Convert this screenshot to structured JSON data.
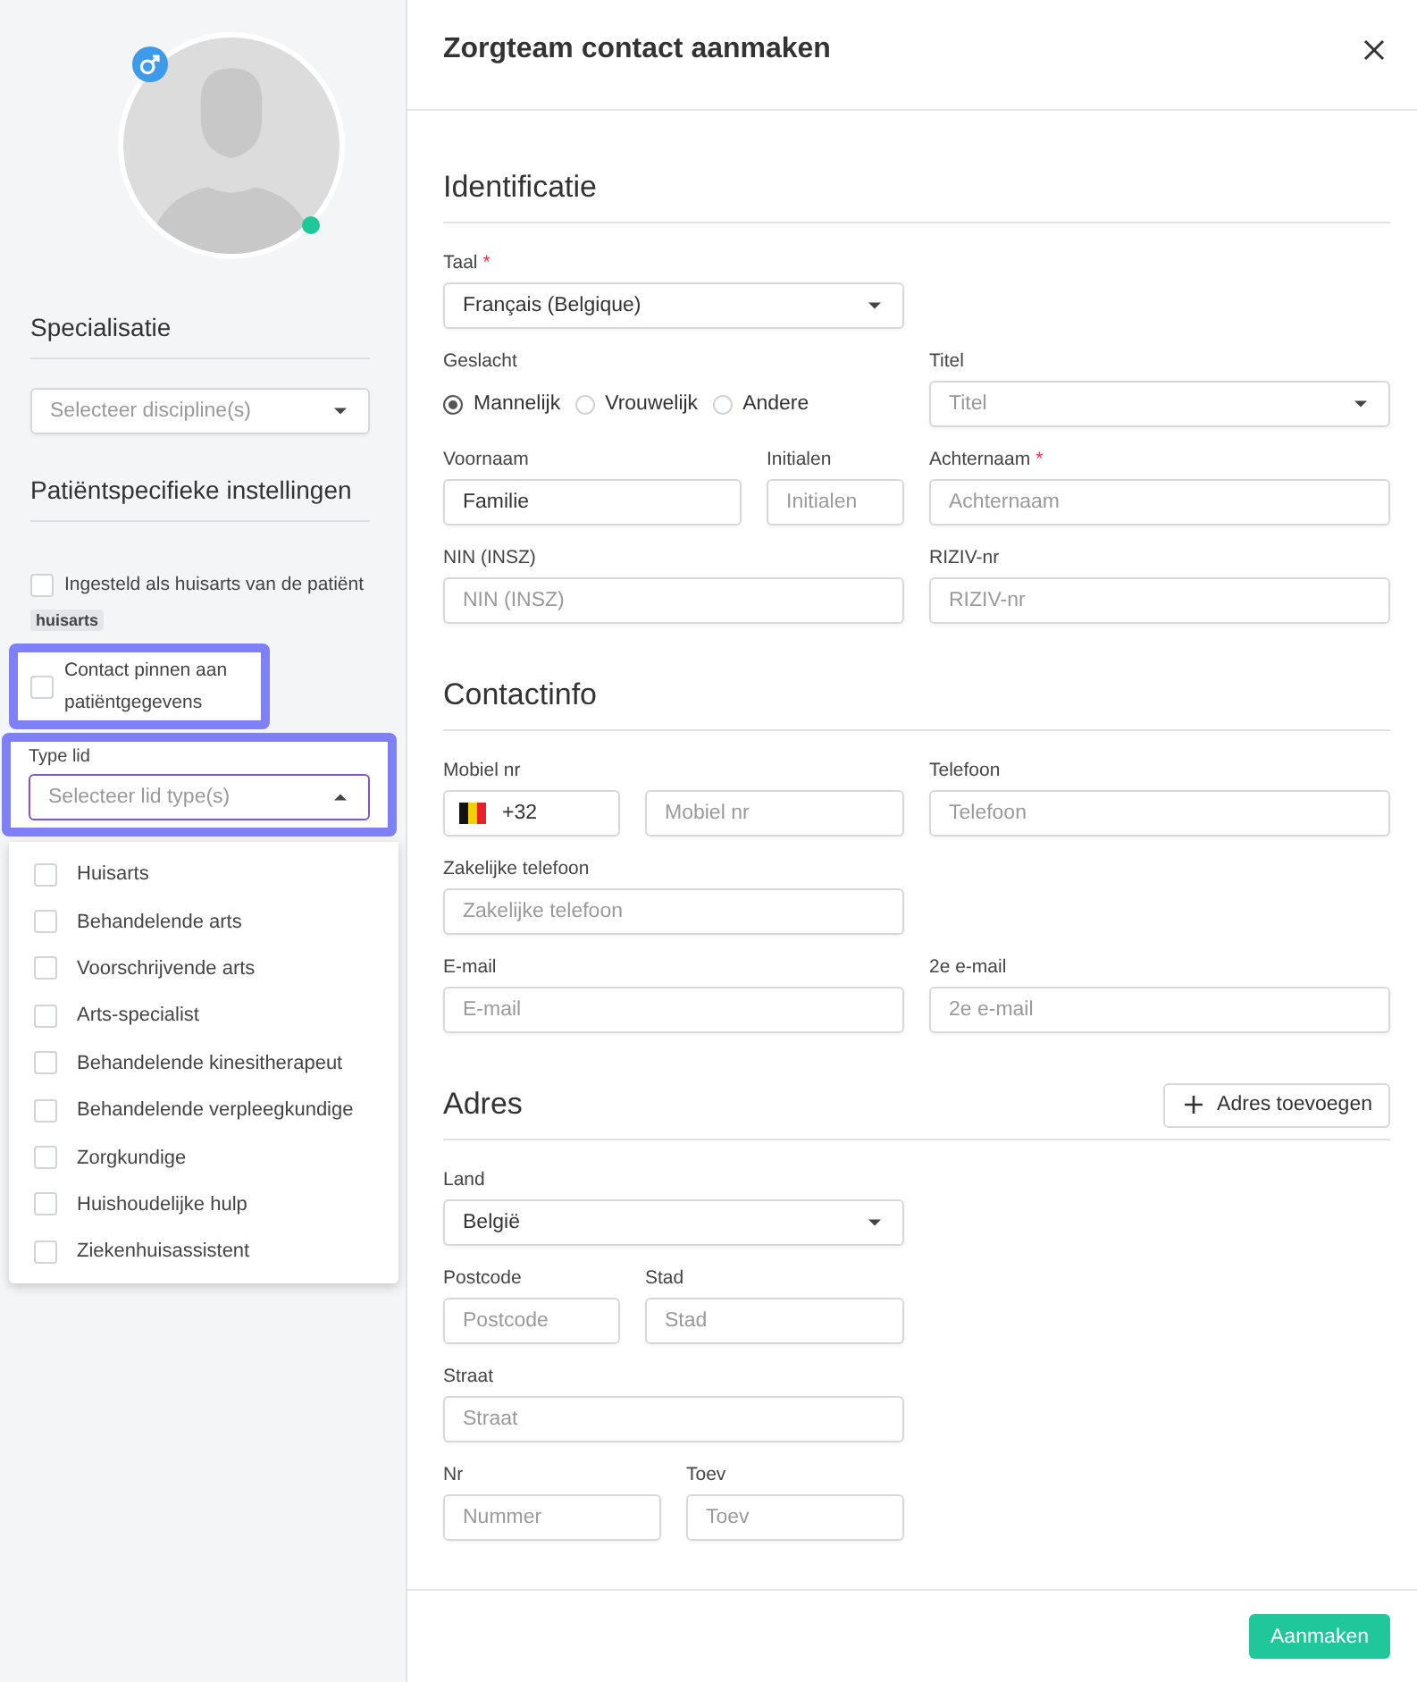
{
  "sidebar": {
    "avatar": {
      "online": true
    },
    "specialisation": {
      "heading": "Specialisatie",
      "placeholder": "Selecteer discipline(s)"
    },
    "patient_settings": {
      "heading": "Patiëntspecifieke instellingen",
      "checkboxes": [
        {
          "label": "Ingesteld als huisarts van de patiënt",
          "checked": false,
          "tag": "huisarts",
          "highlighted": false
        },
        {
          "label": "Contact pinnen aan patiëntgegevens",
          "checked": false,
          "highlighted": true
        }
      ]
    },
    "member_type": {
      "label": "Type lid",
      "placeholder": "Selecteer lid type(s)",
      "expanded": true,
      "highlighted": true,
      "options": [
        {
          "label": "Huisarts",
          "checked": false
        },
        {
          "label": "Behandelende arts",
          "checked": false
        },
        {
          "label": "Voorschrijvende arts",
          "checked": false
        },
        {
          "label": "Arts-specialist",
          "checked": false
        },
        {
          "label": "Behandelende kinesitherapeut",
          "checked": false
        },
        {
          "label": "Behandelende verpleegkundige",
          "checked": false
        },
        {
          "label": "Zorgkundige",
          "checked": false
        },
        {
          "label": "Huishoudelijke hulp",
          "checked": false
        },
        {
          "label": "Ziekenhuisassistent",
          "checked": false
        }
      ]
    }
  },
  "dialog": {
    "title": "Zorgteam contact aanmaken",
    "sections": [
      {
        "heading": "Identificatie",
        "rows": [
          [
            {
              "kind": "select",
              "label": "Taal",
              "required_mark": "*",
              "value": "Français (Belgique)"
            }
          ],
          [
            {
              "kind": "radio",
              "label": "Geslacht",
              "options": [
                {
                  "label": "Mannelijk",
                  "selected": true
                },
                {
                  "label": "Vrouwelijk",
                  "selected": false
                },
                {
                  "label": "Andere",
                  "selected": false
                }
              ]
            },
            {
              "kind": "select",
              "label": "Titel",
              "placeholder": "Titel"
            }
          ],
          [
            {
              "kind": "text",
              "label": "Voornaam",
              "value": "Familie"
            },
            {
              "kind": "text",
              "label": "Initialen",
              "placeholder": "Initialen"
            },
            {
              "kind": "text",
              "label": "Achternaam",
              "required_mark": "*",
              "placeholder": "Achternaam"
            }
          ],
          [
            {
              "kind": "text",
              "label": "NIN (INSZ)",
              "placeholder": "NIN (INSZ)"
            },
            {
              "kind": "text",
              "label": "RIZIV-nr",
              "placeholder": "RIZIV-nr"
            }
          ]
        ]
      },
      {
        "heading": "Contactinfo",
        "rows": [
          [
            {
              "kind": "phone",
              "label": "Mobiel nr",
              "prefix": "+32",
              "placeholder": "Mobiel nr"
            },
            {
              "kind": "text",
              "label": "Telefoon",
              "placeholder": "Telefoon"
            }
          ],
          [
            {
              "kind": "text",
              "label": "Zakelijke telefoon",
              "placeholder": "Zakelijke telefoon"
            }
          ],
          [
            {
              "kind": "text",
              "label": "E-mail",
              "placeholder": "E-mail"
            },
            {
              "kind": "text",
              "label": "2e e-mail",
              "placeholder": "2e e-mail"
            }
          ]
        ]
      },
      {
        "heading": "Adres",
        "action": "Adres toevoegen",
        "rows": [
          [
            {
              "kind": "select",
              "label": "Land",
              "value": "België"
            }
          ],
          [
            {
              "kind": "text",
              "label": "Postcode",
              "placeholder": "Postcode"
            },
            {
              "kind": "text",
              "label": "Stad",
              "placeholder": "Stad"
            }
          ],
          [
            {
              "kind": "text",
              "label": "Straat",
              "placeholder": "Straat"
            }
          ],
          [
            {
              "kind": "text",
              "label": "Nr",
              "placeholder": "Nummer"
            },
            {
              "kind": "text",
              "label": "Toev",
              "placeholder": "Toev"
            }
          ]
        ]
      }
    ],
    "submit": "Aanmaken"
  }
}
